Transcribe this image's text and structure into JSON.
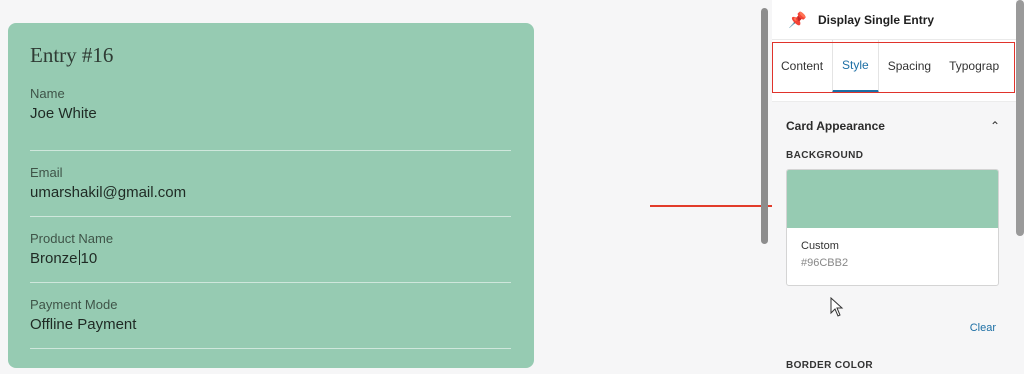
{
  "entry": {
    "title": "Entry #16",
    "fields": [
      {
        "label": "Name",
        "value": "Joe White"
      },
      {
        "label": "Email",
        "value": "umarshakil@gmail.com"
      },
      {
        "label": "Product Name",
        "value_before_caret": "Bronze",
        "value_after_caret": "10"
      },
      {
        "label": "Payment Mode",
        "value": "Offline Payment"
      }
    ]
  },
  "panel": {
    "header_icon": "pin-icon",
    "header_title": "Display Single Entry",
    "tabs": [
      "Content",
      "Style",
      "Spacing",
      "Typograp"
    ],
    "active_tab": "Style",
    "section": {
      "title": "Card Appearance",
      "background_label": "BACKGROUND",
      "swatch_name": "Custom",
      "swatch_hex": "#96CBB2",
      "clear_label": "Clear",
      "border_label": "BORDER COLOR"
    }
  },
  "colors": {
    "card_bg": "#96CBB2",
    "accent": "#1d6fa5",
    "annotation": "#e23b2a"
  }
}
